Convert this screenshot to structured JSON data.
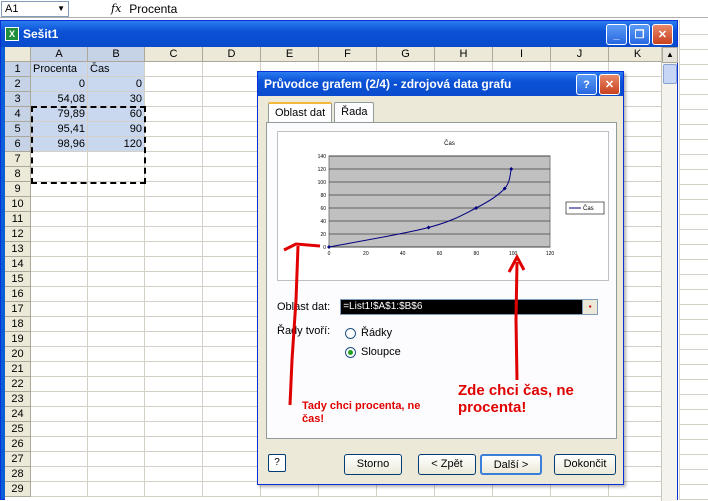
{
  "formula_bar": {
    "name_box": "A1",
    "fx": "fx",
    "content": "Procenta"
  },
  "workbook": {
    "title": "Sešit1",
    "icon": "X"
  },
  "columns": [
    "A",
    "B",
    "C",
    "D",
    "E",
    "F",
    "G",
    "H",
    "I",
    "J",
    "K"
  ],
  "rows": [
    "1",
    "2",
    "3",
    "4",
    "5",
    "6",
    "7",
    "8",
    "9",
    "10",
    "11",
    "12",
    "13",
    "14",
    "15",
    "16",
    "17",
    "18",
    "19",
    "20",
    "21",
    "22",
    "23",
    "24",
    "25",
    "26",
    "27",
    "28",
    "29"
  ],
  "cells": {
    "A1": "Procenta",
    "B1": "Čas",
    "A2": "0",
    "B2": "0",
    "A3": "54,08",
    "B3": "30",
    "A4": "79,89",
    "B4": "60",
    "A5": "95,41",
    "B5": "90",
    "A6": "98,96",
    "B6": "120"
  },
  "dialog": {
    "title": "Průvodce grafem (2/4) - zdrojová data grafu",
    "tabs": [
      "Oblast dat",
      "Řada"
    ],
    "range_label": "Oblast dat:",
    "range_value": "=List1!$A$1:$B$6",
    "series_in_label": "Řady tvoří:",
    "radio_rows": "Řádky",
    "radio_cols": "Sloupce",
    "buttons": {
      "cancel": "Storno",
      "back": "< Zpět",
      "next": "Další >",
      "finish": "Dokončit"
    },
    "help": "?"
  },
  "annotations": {
    "left": "Tady chci procenta, ne čas!",
    "right": "Zde chci čas, ne procenta!"
  },
  "chart_data": {
    "type": "scatter",
    "title": "Čas",
    "series": [
      {
        "name": "Čas",
        "x": [
          0,
          54.08,
          79.89,
          95.41,
          98.96
        ],
        "y": [
          0,
          30,
          60,
          90,
          120
        ]
      }
    ],
    "xticks": [
      "0",
      "20",
      "40",
      "60",
      "80",
      "100",
      "120"
    ],
    "yticks": [
      "0",
      "20",
      "40",
      "60",
      "80",
      "100",
      "120",
      "140"
    ],
    "xlim": [
      0,
      120
    ],
    "ylim": [
      0,
      140
    ],
    "legend": "right",
    "plot_background": "#c0c0c0",
    "line_color": "#000080"
  }
}
